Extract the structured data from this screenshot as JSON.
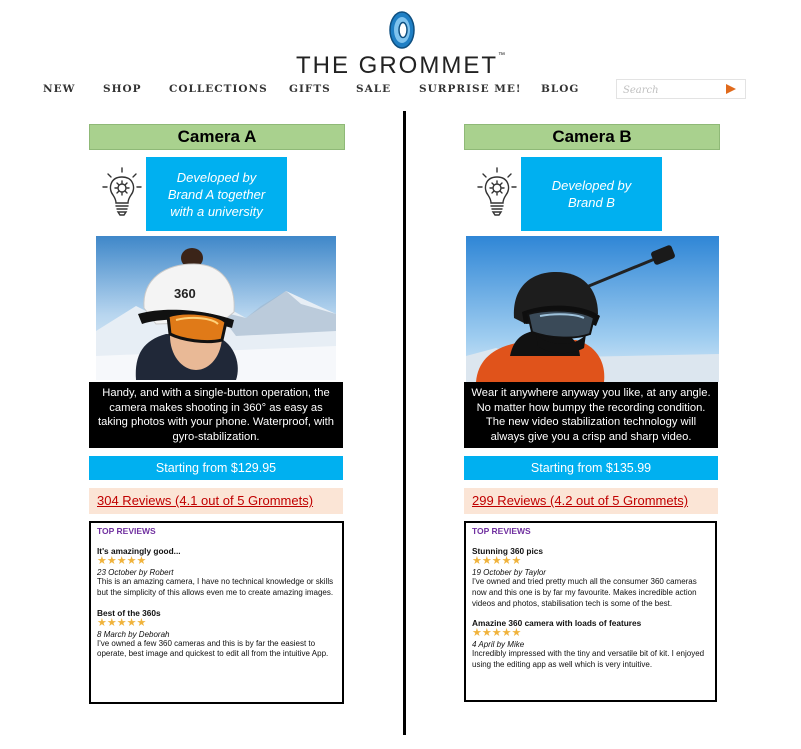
{
  "header": {
    "brand": "THE GROMMET",
    "trademark": "™",
    "search_placeholder": "Search"
  },
  "nav": [
    "NEW",
    "SHOP",
    "COLLECTIONS",
    "GIFTS",
    "SALE",
    "SURPRISE ME!",
    "BLOG"
  ],
  "colors": {
    "title_bar": "#a9d18e",
    "info_blue": "#00b0f0",
    "reviews_bg": "#fbe5d6",
    "reviews_link": "#c00000",
    "top_reviews_heading": "#7030a0",
    "star": "#f0b33c",
    "search_arrow": "#e06a1c"
  },
  "products": [
    {
      "name": "Camera A",
      "developer_note": "Developed by Brand A together with a university",
      "description": "Handy, and with a single-button operation, the camera makes shooting in 360° as easy as taking photos with your phone. Waterproof, with gyro-stabilization.",
      "price": "Starting from $129.95",
      "reviews_link": "304 Reviews (4.1 out of 5 Grommets)",
      "top_reviews_label": "TOP REVIEWS",
      "reviews": [
        {
          "title": "It's amazingly good...",
          "stars": "★★★★★",
          "meta": "23 October by Robert",
          "body": "This is an amazing camera, I have no technical knowledge or skills but the simplicity of this allows even me to create amazing images."
        },
        {
          "title": "Best of the 360s",
          "stars": "★★★★★",
          "meta": "8 March by Deborah",
          "body": "I've owned a few 360 cameras and this is by far the easiest to operate, best image and quickest to edit all from the intuitive App."
        }
      ]
    },
    {
      "name": "Camera B",
      "developer_note": "Developed by Brand B",
      "description": "Wear it anywhere anyway you like, at any angle. No matter how bumpy the recording condition. The new video stabilization technology will always give you a crisp and sharp video.",
      "price": "Starting from $135.99",
      "reviews_link": "299 Reviews (4.2 out of 5 Grommets)",
      "top_reviews_label": "TOP REVIEWS",
      "reviews": [
        {
          "title": "Stunning 360 pics",
          "stars": "★★★★★",
          "meta": "19 October by Taylor",
          "body": "I've owned and tried pretty much all the consumer 360 cameras now and this one is by far my favourite. Makes incredible action videos and photos, stabilisation tech is some of the best."
        },
        {
          "title": "Amazine 360 camera with loads of features",
          "stars": "★★★★★",
          "meta": "4 April by Mike",
          "body": "Incredibly impressed with the tiny and versatile bit of kit. I enjoyed using the editing app as well which is very intuitive."
        }
      ]
    }
  ]
}
